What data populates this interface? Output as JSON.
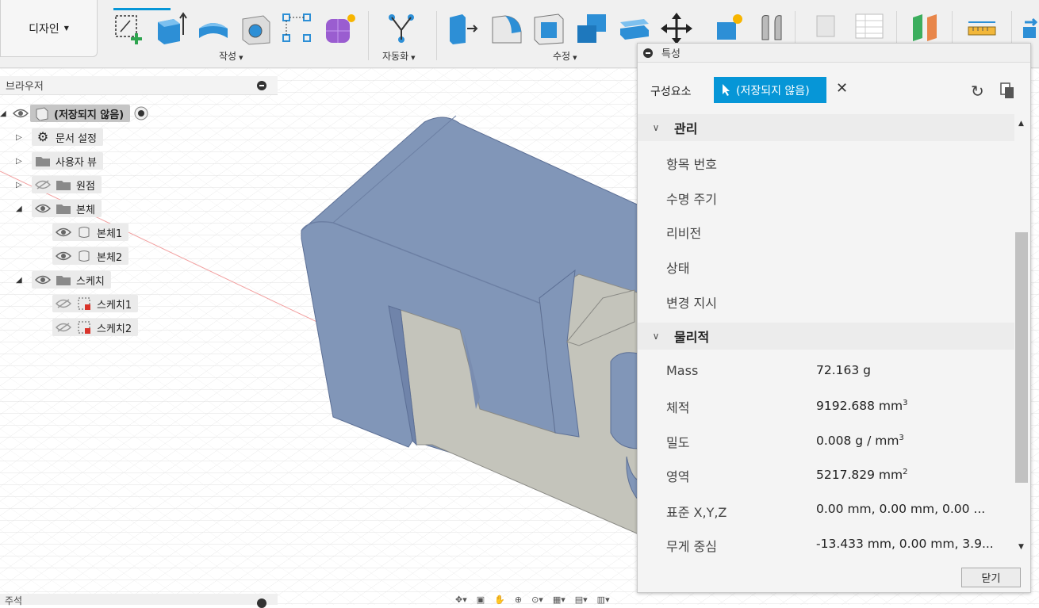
{
  "toolbar": {
    "workspace": "디자인",
    "groups": {
      "create": "작성",
      "automate": "자동화",
      "modify": "수정"
    }
  },
  "browser": {
    "title": "브라우저",
    "items": [
      {
        "label": "(저장되지 않음)"
      },
      {
        "label": "문서 설정"
      },
      {
        "label": "사용자 뷰"
      },
      {
        "label": "원점"
      },
      {
        "label": "본체"
      },
      {
        "label": "본체1"
      },
      {
        "label": "본체2"
      },
      {
        "label": "스케치"
      },
      {
        "label": "스케치1"
      },
      {
        "label": "스케치2"
      }
    ]
  },
  "bottom": {
    "comments": "주석"
  },
  "properties": {
    "title": "특성",
    "selection_label": "구성요소",
    "selection_value": "(저장되지 않음)",
    "manage_section": "관리",
    "manage_items": [
      "항목 번호",
      "수명 주기",
      "리비전",
      "상태",
      "변경 지시"
    ],
    "physical_section": "물리적",
    "physical": [
      {
        "label": "Mass",
        "value": "72.163 g",
        "sup": ""
      },
      {
        "label": "체적",
        "value": "9192.688 mm",
        "sup": "3"
      },
      {
        "label": "밀도",
        "value": "0.008 g / mm",
        "sup": "3"
      },
      {
        "label": "영역",
        "value": "5217.829 mm",
        "sup": "2"
      },
      {
        "label": "표준 X,Y,Z",
        "value": "0.00 mm, 0.00 mm, 0.00 ...",
        "sup": ""
      },
      {
        "label": "무게 중심",
        "value": "-13.433 mm, 0.00 mm, 3.9...",
        "sup": ""
      }
    ],
    "close": "닫기"
  },
  "colors": {
    "accent": "#0696d7",
    "body": "#8196b8",
    "cut_face": "#c4c4bb"
  }
}
